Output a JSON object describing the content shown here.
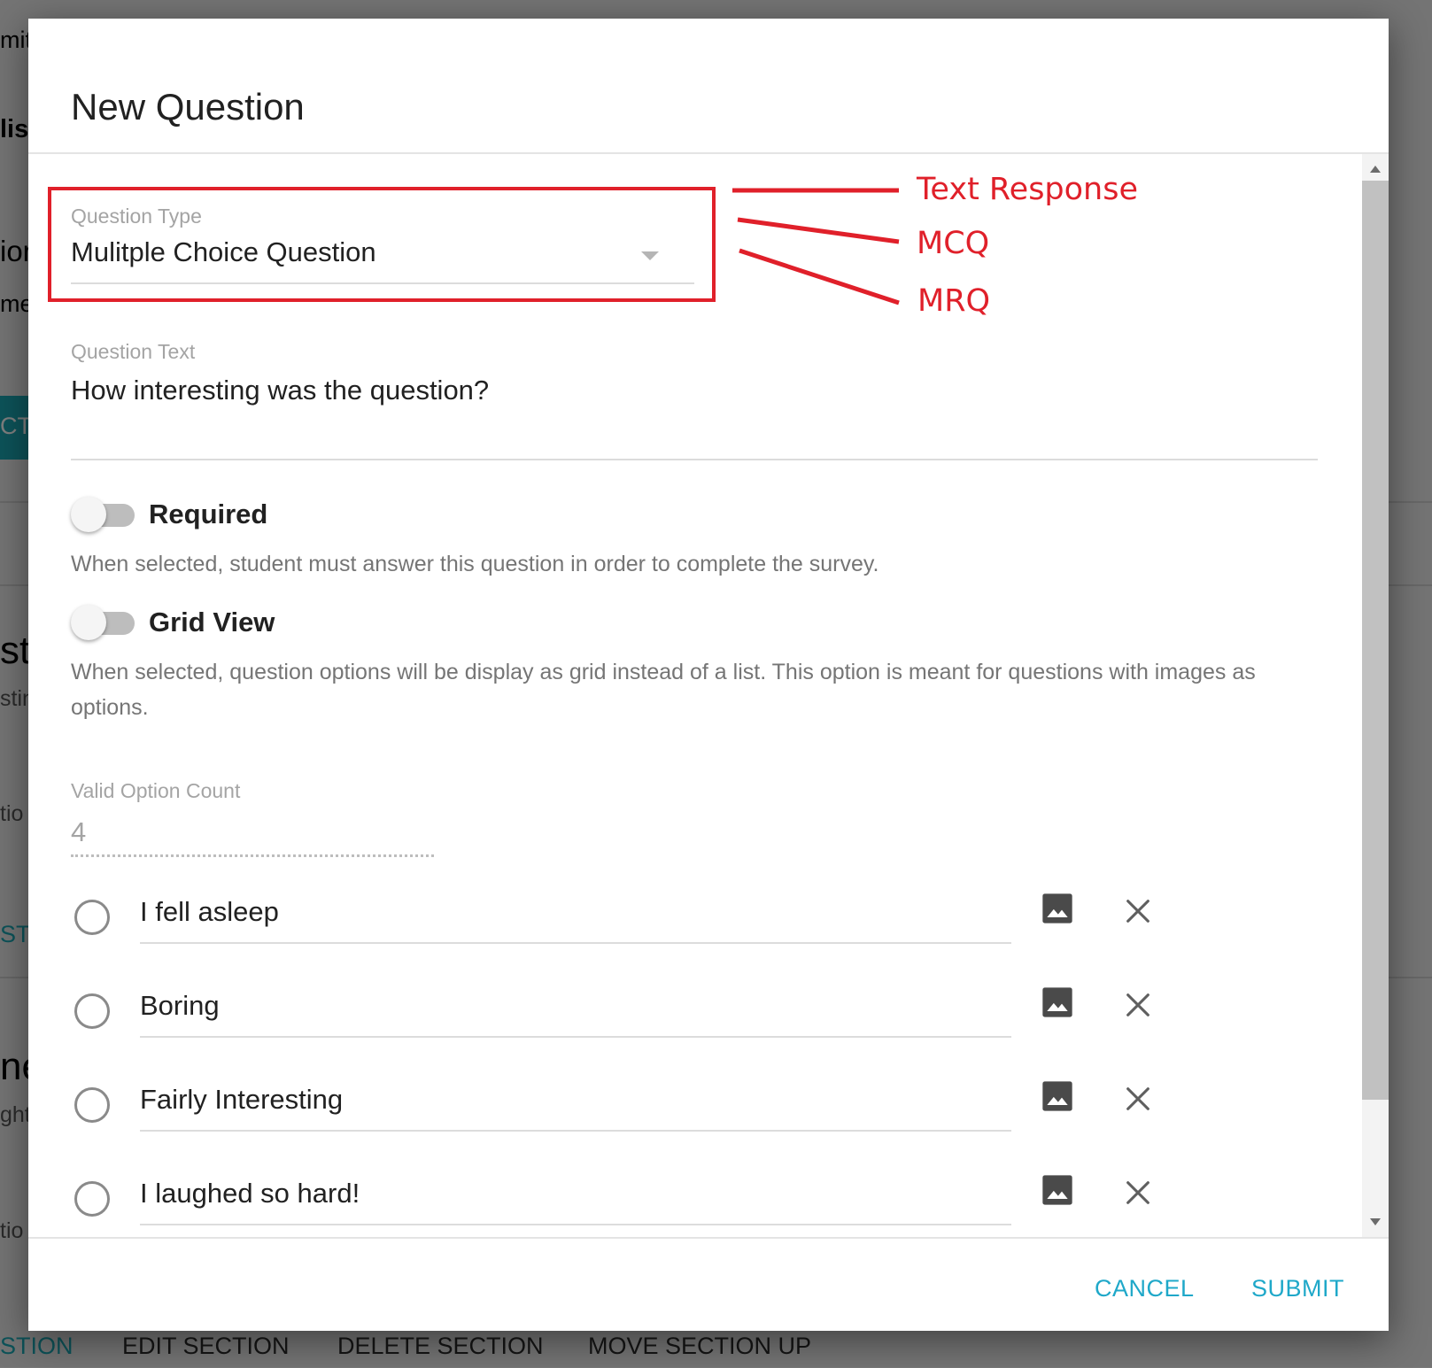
{
  "background": {
    "fragments": [
      "mitt",
      "lish",
      "ion",
      "me",
      "CT",
      "sti",
      "stin",
      "tio",
      "STI",
      "ne",
      "ght",
      "tio"
    ],
    "toolbar": [
      "STION",
      "EDIT SECTION",
      "DELETE SECTION",
      "MOVE SECTION UP"
    ]
  },
  "dialog": {
    "title": "New Question",
    "question_type": {
      "label": "Question Type",
      "value": "Mulitple Choice Question"
    },
    "question_text": {
      "label": "Question Text",
      "value": "How interesting was the question?"
    },
    "required": {
      "label": "Required",
      "on": false,
      "help": "When selected, student must answer this question in order to complete the survey."
    },
    "grid_view": {
      "label": "Grid View",
      "on": false,
      "help": "When selected, question options will be display as grid instead of a list. This option is meant for questions with images as options."
    },
    "valid_option_count": {
      "label": "Valid Option Count",
      "value": "4"
    },
    "options": [
      {
        "text": "I fell asleep"
      },
      {
        "text": "Boring"
      },
      {
        "text": "Fairly Interesting"
      },
      {
        "text": "I laughed so hard!"
      }
    ],
    "actions": {
      "cancel": "CANCEL",
      "submit": "SUBMIT"
    }
  },
  "annotations": {
    "color": "#e0202a",
    "labels": [
      "Text Response",
      "MCQ",
      "MRQ"
    ]
  },
  "colors": {
    "accent": "#1fa8c9",
    "highlight": "#e0202a"
  }
}
